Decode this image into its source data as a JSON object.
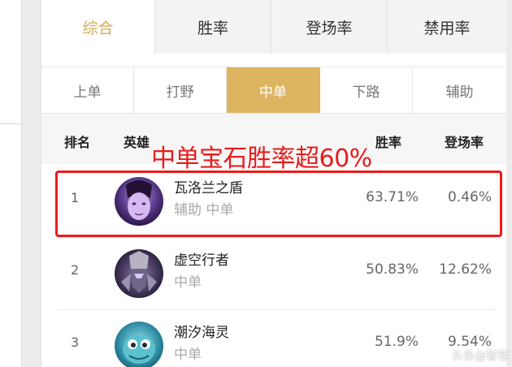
{
  "top_tabs": [
    {
      "label": "综合",
      "active": true
    },
    {
      "label": "胜率",
      "active": false
    },
    {
      "label": "登场率",
      "active": false
    },
    {
      "label": "禁用率",
      "active": false
    }
  ],
  "lane_tabs": [
    {
      "label": "上单",
      "active": false
    },
    {
      "label": "打野",
      "active": false
    },
    {
      "label": "中单",
      "active": true
    },
    {
      "label": "下路",
      "active": false
    },
    {
      "label": "辅助",
      "active": false
    }
  ],
  "table": {
    "headers": {
      "rank": "排名",
      "hero": "英雄",
      "winrate": "胜率",
      "pickrate": "登场率"
    },
    "rows": [
      {
        "rank": "1",
        "name": "瓦洛兰之盾",
        "role": "辅助 中单",
        "winrate": "63.71%",
        "pickrate": "0.46%",
        "avatar": "taric-portrait"
      },
      {
        "rank": "2",
        "name": "虚空行者",
        "role": "中单",
        "winrate": "50.83%",
        "pickrate": "12.62%",
        "avatar": "kassadin-portrait"
      },
      {
        "rank": "3",
        "name": "潮汐海灵",
        "role": "中单",
        "winrate": "51.9%",
        "pickrate": "9.54%",
        "avatar": "fizz-portrait"
      }
    ]
  },
  "annotation": "中单宝石胜率超60%",
  "watermark": "头条@智客",
  "colors": {
    "accent_gold": "#ddb561",
    "active_tab_text": "#d4ad5a",
    "annotation_red": "#e81c1c"
  }
}
